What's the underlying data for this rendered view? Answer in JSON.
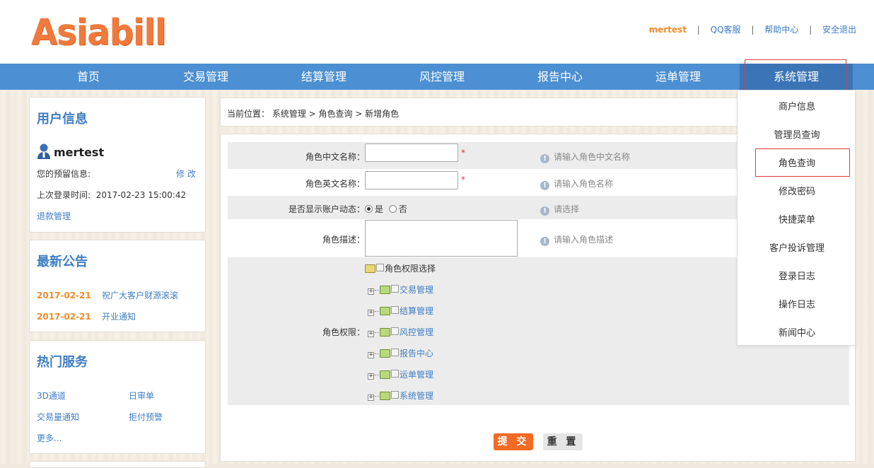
{
  "header": {
    "logo": "Asiabill",
    "username": "mertest",
    "links": [
      "QQ客服",
      "帮助中心",
      "安全退出"
    ]
  },
  "nav": [
    "首页",
    "交易管理",
    "结算管理",
    "风控管理",
    "报告中心",
    "运单管理",
    "系统管理"
  ],
  "user_panel": {
    "title": "用户信息",
    "name": "mertest",
    "reserved_label": "您的预留信息:",
    "edit": "修 改",
    "last_login_label": "上次登录时间:",
    "last_login": "2017-02-23 15:00:42",
    "refund": "退款管理"
  },
  "news_panel": {
    "title": "最新公告",
    "items": [
      {
        "date": "2017-02-21",
        "text": "祝广大客户财源滚滚"
      },
      {
        "date": "2017-02-21",
        "text": "开业通知"
      }
    ]
  },
  "services_panel": {
    "title": "热门服务",
    "items": [
      "3D通道",
      "日审单",
      "交易量通知",
      "拒付预警"
    ],
    "more": "更多..."
  },
  "breadcrumb": "当前位置： 系统管理 > 角色查询 > 新增角色",
  "form": {
    "cn_name_label": "角色中文名称：",
    "cn_name_hint": "请输入角色中文名称",
    "en_name_label": "角色英文名称：",
    "en_name_hint": "请输入角色名称",
    "required_mark": "*",
    "show_dynamic_label": "是否显示账户动态：",
    "yes": "是",
    "no": "否",
    "show_dynamic_hint": "请选择",
    "desc_label": "角色描述：",
    "desc_hint": "请输入角色描述",
    "perm_label": "角色权限：",
    "tree_root": "角色权限选择",
    "tree_nodes": [
      "交易管理",
      "结算管理",
      "风控管理",
      "报告中心",
      "运单管理",
      "系统管理"
    ],
    "hint_icon": "info-icon",
    "submit": "提 交",
    "reset": "重 置"
  },
  "dropdown": [
    "商户信息",
    "管理员查询",
    "角色查询",
    "修改密码",
    "快捷菜单",
    "客户投诉管理",
    "登录日志",
    "操作日志",
    "新闻中心"
  ],
  "colors": {
    "nav": "#4c8fd2",
    "accent": "#f26a24",
    "link": "#3f7ec4",
    "highlight": "#e03b3b"
  }
}
